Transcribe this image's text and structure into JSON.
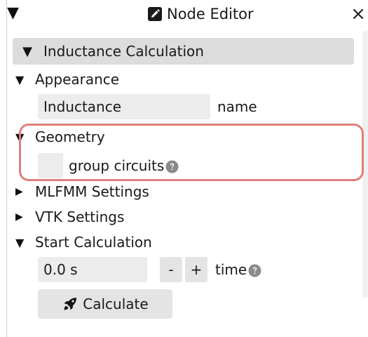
{
  "window": {
    "title": "Node Editor",
    "collapse_glyph": "▼",
    "close_glyph": "×",
    "title_icon": "pencil-square-icon"
  },
  "section": {
    "label": "Inductance Calculation",
    "glyph": "▼"
  },
  "appearance": {
    "label": "Appearance",
    "glyph": "▼",
    "name_value": "Inductance",
    "name_label": "name"
  },
  "geometry": {
    "label": "Geometry",
    "glyph": "▼",
    "group_circuits_label": "group circuits",
    "group_circuits_checked": false,
    "help_icon": "question-circle-icon"
  },
  "mlfmm": {
    "label": "MLFMM Settings",
    "glyph": "▶"
  },
  "vtk": {
    "label": "VTK Settings",
    "glyph": "▶"
  },
  "start_calculation": {
    "label": "Start Calculation",
    "glyph": "▼",
    "time_value": "0.0 s",
    "minus_label": "-",
    "plus_label": "+",
    "time_label": "time",
    "help_icon": "question-circle-icon",
    "calculate_label": "Calculate",
    "calculate_icon": "rocket-icon"
  },
  "colors": {
    "header_bg": "#dcdcdc",
    "field_bg": "#ececec",
    "button_bg": "#e4e4e4",
    "highlight_border": "#e07f7c",
    "help_icon_color": "#8a8a8a"
  }
}
